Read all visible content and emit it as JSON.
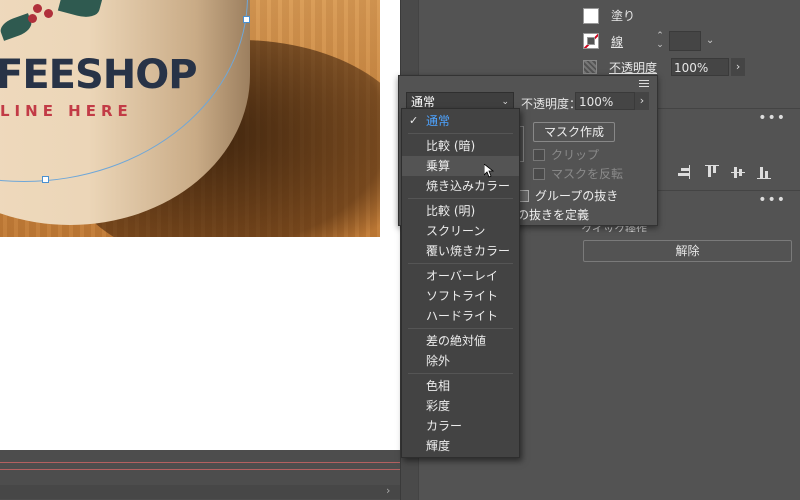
{
  "canvas": {
    "artwork": {
      "brand_text": "FEESHOP",
      "tagline": "LINE HERE"
    }
  },
  "properties": {
    "fill_label": "塗り",
    "stroke_label": "線",
    "opacity_label": "不透明度",
    "opacity_value": "100%",
    "release_button": "解除",
    "section_title": "クイック操作"
  },
  "transparency_panel": {
    "blend_mode": "通常",
    "opacity_label": "不透明度：",
    "opacity_value": "100%",
    "make_mask_button": "マスク作成",
    "clip_label": "クリップ",
    "invert_mask_label": "マスクを反転",
    "knockout_group_label": "グループの抜き",
    "define_knockout_label": "の抜きを定義"
  },
  "blend_menu": {
    "groups": [
      [
        "通常"
      ],
      [
        "比較 (暗)",
        "乗算",
        "焼き込みカラー"
      ],
      [
        "比較 (明)",
        "スクリーン",
        "覆い焼きカラー"
      ],
      [
        "オーバーレイ",
        "ソフトライト",
        "ハードライト"
      ],
      [
        "差の絶対値",
        "除外"
      ],
      [
        "色相",
        "彩度",
        "カラー",
        "輝度"
      ]
    ],
    "selected": "通常",
    "hovered": "乗算"
  },
  "colors": {
    "panel_bg": "#535353",
    "menu_bg": "#434343",
    "selected_text": "#4da3ff",
    "stroke_red": "#d0021b"
  }
}
